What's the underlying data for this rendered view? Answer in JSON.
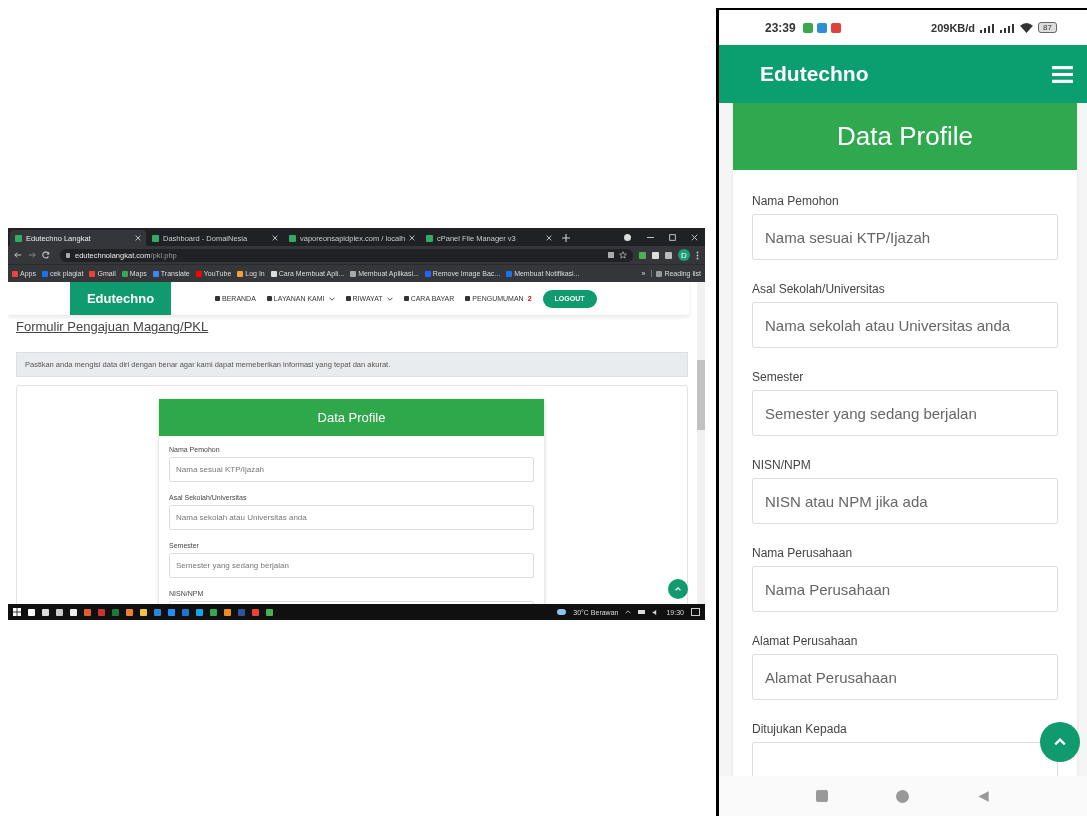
{
  "desktop": {
    "browser_tabs": [
      {
        "title": "Edutechno Langkat",
        "selected": true
      },
      {
        "title": "Dashboard - DomaiNesia",
        "selected": false
      },
      {
        "title": "vaporeonsapidplex.com / localh",
        "selected": false
      },
      {
        "title": "cPanel File Manager v3",
        "selected": false
      }
    ],
    "address": {
      "host": "edutechnolangkat.com",
      "path": "/pkl.php"
    },
    "bookmarks": [
      "Apps",
      "cek plagiat",
      "Gmail",
      "Maps",
      "Translate",
      "YouTube",
      "Log In",
      "Cara Membuat Apli...",
      "Membuat Aplikasi...",
      "Remove Image Bac...",
      "Membuat Notifikasi..."
    ],
    "bookmarks_more": "»",
    "reading_list": "Reading list",
    "profile_initial": "D",
    "site": {
      "logo": "Edutechno",
      "nav": [
        {
          "label": "BERANDA",
          "dropdown": false
        },
        {
          "label": "LAYANAN KAMI",
          "dropdown": true
        },
        {
          "label": "RIWAYAT",
          "dropdown": true
        },
        {
          "label": "CARA BAYAR",
          "dropdown": false
        },
        {
          "label": "PENGUMUMAN",
          "dropdown": false,
          "badge": "2"
        }
      ],
      "logout": "LOGOUT",
      "page_title": "Formulir Pengajuan Magang/PKL",
      "alert": "Pastikan anda mengisi data diri dengan benar agar kami dapat memeberikan informasi yang tepat dan akurat.",
      "form_title": "Data Profile",
      "fields": [
        {
          "label": "Nama Pemohon",
          "placeholder": "Nama sesuai KTP/Ijazah"
        },
        {
          "label": "Asal Sekolah/Universitas",
          "placeholder": "Nama sekolah atau Universitas anda"
        },
        {
          "label": "Semester",
          "placeholder": "Semester yang sedang berjalan"
        },
        {
          "label": "NISN/NPM"
        }
      ]
    },
    "taskbar": {
      "weather": "30°C  Berawan",
      "time": "19:30"
    }
  },
  "phone": {
    "status": {
      "time": "23:39",
      "speed": "209KB/d",
      "battery": "87"
    },
    "app_title": "Edutechno",
    "form_title": "Data Profile",
    "fields": [
      {
        "label": "Nama Pemohon",
        "placeholder": "Nama sesuai KTP/Ijazah"
      },
      {
        "label": "Asal Sekolah/Universitas",
        "placeholder": "Nama sekolah atau Universitas anda"
      },
      {
        "label": "Semester",
        "placeholder": "Semester yang sedang berjalan"
      },
      {
        "label": "NISN/NPM",
        "placeholder": "NISN atau NPM jika ada"
      },
      {
        "label": "Nama Perusahaan",
        "placeholder": "Nama Perusahaan"
      },
      {
        "label": "Alamat Perusahaan",
        "placeholder": "Alamat Perusahaan"
      },
      {
        "label": "Ditujukan Kepada"
      }
    ]
  }
}
